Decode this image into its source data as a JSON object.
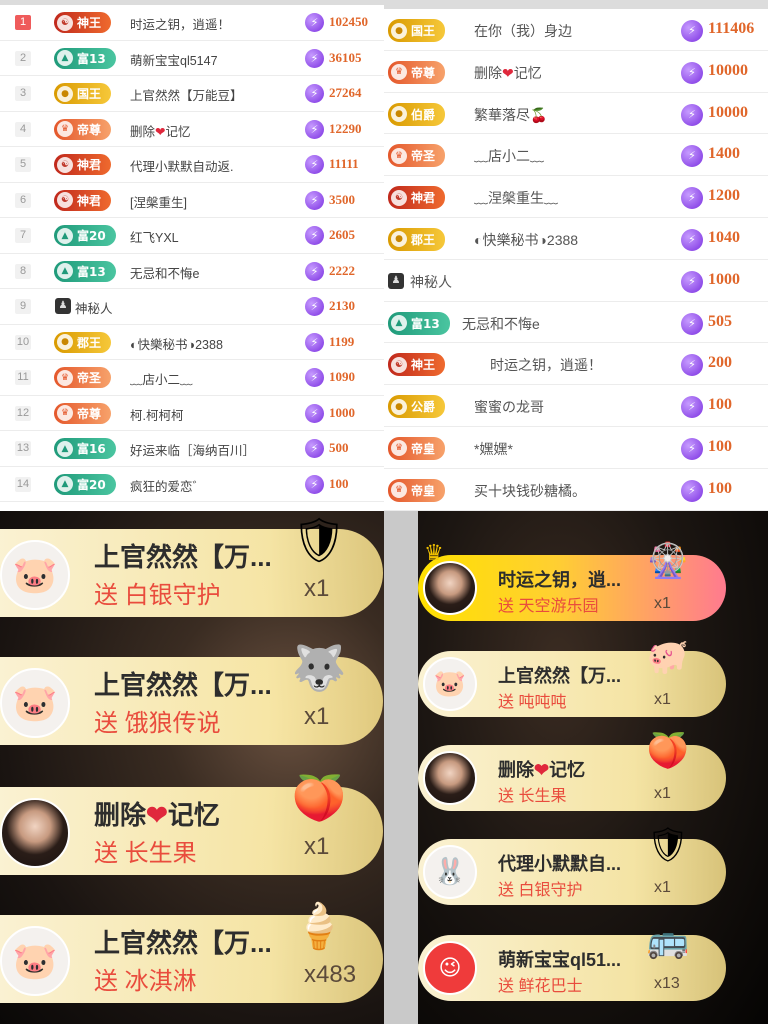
{
  "left_board": {
    "rows": [
      {
        "rank": "1",
        "level": "神王",
        "name": "时运之钥，逍遥！",
        "amount": "102450",
        "style": "shenwang"
      },
      {
        "rank": "2",
        "level": "富13",
        "name": "萌新宝宝ql5147",
        "amount": "36105",
        "style": "fu"
      },
      {
        "rank": "3",
        "level": "国王",
        "name": "上官然然【万能豆】",
        "amount": "27264",
        "style": "gold"
      },
      {
        "rank": "4",
        "level": "帝尊",
        "name_a": "删除",
        "name_b": "记忆",
        "amount": "12290",
        "style": "orange",
        "heart": true
      },
      {
        "rank": "5",
        "level": "神君",
        "name": "代理小默默自动返.",
        "amount": "11111",
        "style": "shenwang"
      },
      {
        "rank": "6",
        "level": "神君",
        "name": "[涅槃重生]",
        "amount": "3500",
        "style": "shenwang"
      },
      {
        "rank": "7",
        "level": "富20",
        "name": "红飞YXL",
        "amount": "2605",
        "style": "fu"
      },
      {
        "rank": "8",
        "level": "富13",
        "name": "无忌和不悔e",
        "amount": "2222",
        "style": "fu"
      },
      {
        "rank": "9",
        "level": "",
        "name": "神秘人",
        "amount": "2130",
        "style": "mystery"
      },
      {
        "rank": "10",
        "level": "郡王",
        "name": "◐快樂秘书◑2388",
        "amount": "1199",
        "style": "gold"
      },
      {
        "rank": "11",
        "level": "帝圣",
        "name": "﹏店小二﹏",
        "amount": "1090",
        "style": "orange"
      },
      {
        "rank": "12",
        "level": "帝尊",
        "name": "柯.柯柯柯",
        "amount": "1000",
        "style": "orange"
      },
      {
        "rank": "13",
        "level": "富16",
        "name": "好运来临［海纳百川］",
        "amount": "500",
        "style": "fu"
      },
      {
        "rank": "14",
        "level": "富20",
        "name": "疯狂的爱恋゛",
        "amount": "100",
        "style": "fu"
      }
    ]
  },
  "right_board": {
    "rows": [
      {
        "level": "国王",
        "name": "在你（我）身边",
        "amount": "111406",
        "style": "gold"
      },
      {
        "level": "帝尊",
        "name_a": "删除",
        "name_b": "记忆",
        "amount": "10000",
        "style": "orange",
        "heart": true
      },
      {
        "level": "伯爵",
        "name": "繁華落尽🍒",
        "amount": "10000",
        "style": "gold"
      },
      {
        "level": "帝圣",
        "name": "﹏店小二﹏",
        "amount": "1400",
        "style": "orange"
      },
      {
        "level": "神君",
        "name": "﹏涅槃重生﹏",
        "amount": "1200",
        "style": "shenwang"
      },
      {
        "level": "郡王",
        "name": "◐快樂秘书◑2388",
        "amount": "1040",
        "style": "gold"
      },
      {
        "level": "",
        "name": "神秘人",
        "amount": "1000",
        "style": "mystery"
      },
      {
        "level": "富13",
        "name": "无忌和不悔e",
        "amount": "505",
        "style": "fu"
      },
      {
        "level": "神王",
        "name": "时运之钥，逍遥！",
        "amount": "200",
        "style": "shenwang"
      },
      {
        "level": "公爵",
        "name": "蜜蜜の龙哥",
        "amount": "100",
        "style": "gold"
      },
      {
        "level": "帝皇",
        "name": "*嫼嫼*",
        "amount": "100",
        "style": "orange"
      },
      {
        "level": "帝皇",
        "name": "买十块钱砂糖橘。",
        "amount": "100",
        "style": "orange"
      }
    ]
  },
  "left_gifts": [
    {
      "name": "上官然然【万...",
      "gift": "送 白银守护",
      "qty": "x1",
      "avatar": "pig",
      "art": "silver-shield"
    },
    {
      "name": "上官然然【万...",
      "gift": "送 饿狼传说",
      "qty": "x1",
      "avatar": "pig",
      "art": "wolf"
    },
    {
      "name_a": "删除",
      "name_b": "记忆",
      "heart": true,
      "gift": "送 长生果",
      "qty": "x1",
      "avatar": "girl",
      "art": "peach"
    },
    {
      "name": "上官然然【万...",
      "gift": "送 冰淇淋",
      "qty": "x483",
      "avatar": "pig",
      "art": "ice-cream"
    }
  ],
  "right_gifts": [
    {
      "name": "时运之钥，逍...",
      "gift": "送 天空游乐园",
      "qty": "x1",
      "avatar": "girl",
      "art": "amusement-park",
      "highlight": true
    },
    {
      "name": "上官然然【万...",
      "gift": "送 吨吨吨",
      "qty": "x1",
      "avatar": "pig",
      "art": "drink-pig"
    },
    {
      "name_a": "删除",
      "name_b": "记忆",
      "heart": true,
      "gift": "送 长生果",
      "qty": "x1",
      "avatar": "girl",
      "art": "peach"
    },
    {
      "name": "代理小默默自...",
      "gift": "送 白银守护",
      "qty": "x1",
      "avatar": "rabbit",
      "art": "silver-shield"
    },
    {
      "name": "萌新宝宝ql51...",
      "gift": "送 鲜花巴士",
      "qty": "x13",
      "avatar": "red-face",
      "art": "flower-bus"
    }
  ],
  "colors": {
    "amount": "#e0662a",
    "gift_text": "#e94c3d",
    "coin": "#7a2fe0"
  }
}
